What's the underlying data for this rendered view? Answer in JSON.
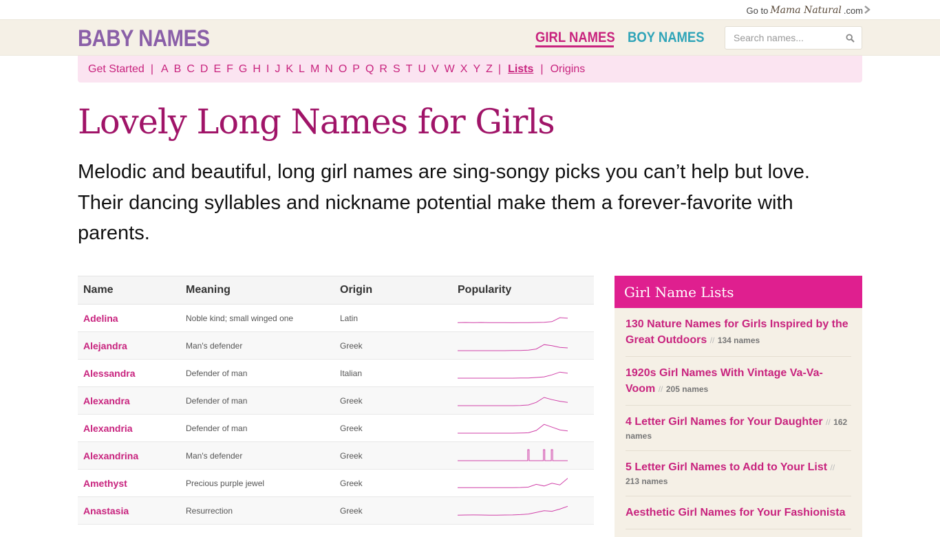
{
  "topstrip": {
    "goto_prefix": "Go to",
    "brand": "Mama Natural",
    "brand_suffix": ".com"
  },
  "header": {
    "logo": "BABY NAMES",
    "nav_girl": "GIRL NAMES",
    "nav_boy": "BOY NAMES",
    "search_placeholder": "Search names..."
  },
  "alphabar": {
    "get_started": "Get Started",
    "letters": [
      "A",
      "B",
      "C",
      "D",
      "E",
      "F",
      "G",
      "H",
      "I",
      "J",
      "K",
      "L",
      "M",
      "N",
      "O",
      "P",
      "Q",
      "R",
      "S",
      "T",
      "U",
      "V",
      "W",
      "X",
      "Y",
      "Z"
    ],
    "lists": "Lists",
    "origins": "Origins"
  },
  "page": {
    "title": "Lovely Long Names for Girls",
    "intro": "Melodic and beautiful, long girl names are sing-songy picks you can’t help but love. Their dancing syllables and nickname potential make them a forever-favorite with parents."
  },
  "table": {
    "headers": [
      "Name",
      "Meaning",
      "Origin",
      "Popularity"
    ],
    "rows": [
      {
        "name": "Adelina",
        "meaning": "Noble kind; small winged one",
        "origin": "Latin",
        "trend": [
          0.05,
          0.06,
          0.05,
          0.06,
          0.05,
          0.05,
          0.05,
          0.04,
          0.05,
          0.05,
          0.06,
          0.08,
          0.14,
          0.5,
          0.45
        ]
      },
      {
        "name": "Alejandra",
        "meaning": "Man's defender",
        "origin": "Greek",
        "trend": [
          0.0,
          0.0,
          0.0,
          0.0,
          0.0,
          0.0,
          0.0,
          0.01,
          0.02,
          0.05,
          0.15,
          0.55,
          0.45,
          0.3,
          0.25
        ]
      },
      {
        "name": "Alessandra",
        "meaning": "Defender of man",
        "origin": "Italian",
        "trend": [
          0.0,
          0.0,
          0.0,
          0.0,
          0.0,
          0.0,
          0.0,
          0.0,
          0.01,
          0.02,
          0.06,
          0.12,
          0.3,
          0.55,
          0.45
        ]
      },
      {
        "name": "Alexandra",
        "meaning": "Defender of man",
        "origin": "Greek",
        "trend": [
          0.0,
          0.0,
          0.0,
          0.0,
          0.0,
          0.0,
          0.0,
          0.0,
          0.02,
          0.06,
          0.3,
          0.75,
          0.55,
          0.4,
          0.3
        ]
      },
      {
        "name": "Alexandria",
        "meaning": "Defender of man",
        "origin": "Greek",
        "trend": [
          0.0,
          0.0,
          0.0,
          0.0,
          0.0,
          0.0,
          0.0,
          0.0,
          0.01,
          0.04,
          0.25,
          0.8,
          0.55,
          0.3,
          0.2
        ]
      },
      {
        "name": "Alexandrina",
        "meaning": "Man's defender",
        "origin": "Greek",
        "trend": [
          0,
          0,
          0,
          0,
          0,
          0,
          0,
          0,
          0,
          1,
          0,
          1,
          1,
          0,
          0
        ]
      },
      {
        "name": "Amethyst",
        "meaning": "Precious purple jewel",
        "origin": "Greek",
        "trend": [
          0.05,
          0.05,
          0.05,
          0.05,
          0.05,
          0.05,
          0.05,
          0.05,
          0.06,
          0.1,
          0.35,
          0.2,
          0.45,
          0.3,
          0.9
        ]
      },
      {
        "name": "Anastasia",
        "meaning": "Resurrection",
        "origin": "Greek",
        "trend": [
          0.05,
          0.06,
          0.07,
          0.06,
          0.05,
          0.05,
          0.06,
          0.07,
          0.1,
          0.15,
          0.3,
          0.45,
          0.4,
          0.6,
          0.85
        ]
      }
    ]
  },
  "sidebar": {
    "title": "Girl Name Lists",
    "items": [
      {
        "title": "130 Nature Names for Girls Inspired by the Great Outdoors",
        "count": "134 names"
      },
      {
        "title": "1920s Girl Names With Vintage Va-Va-Voom",
        "count": "205 names"
      },
      {
        "title": "4 Letter Girl Names for Your Daughter",
        "count": "162 names"
      },
      {
        "title": "5 Letter Girl Names to Add to Your List",
        "count": "213 names"
      },
      {
        "title": "Aesthetic Girl Names for Your Fashionista",
        "count": ""
      }
    ]
  },
  "colors": {
    "accent": "#c8237e",
    "logo": "#8a5fa8",
    "boy": "#2fa4b8",
    "sidebar_head": "#df1f8f",
    "sparkline": "#d040a8"
  }
}
